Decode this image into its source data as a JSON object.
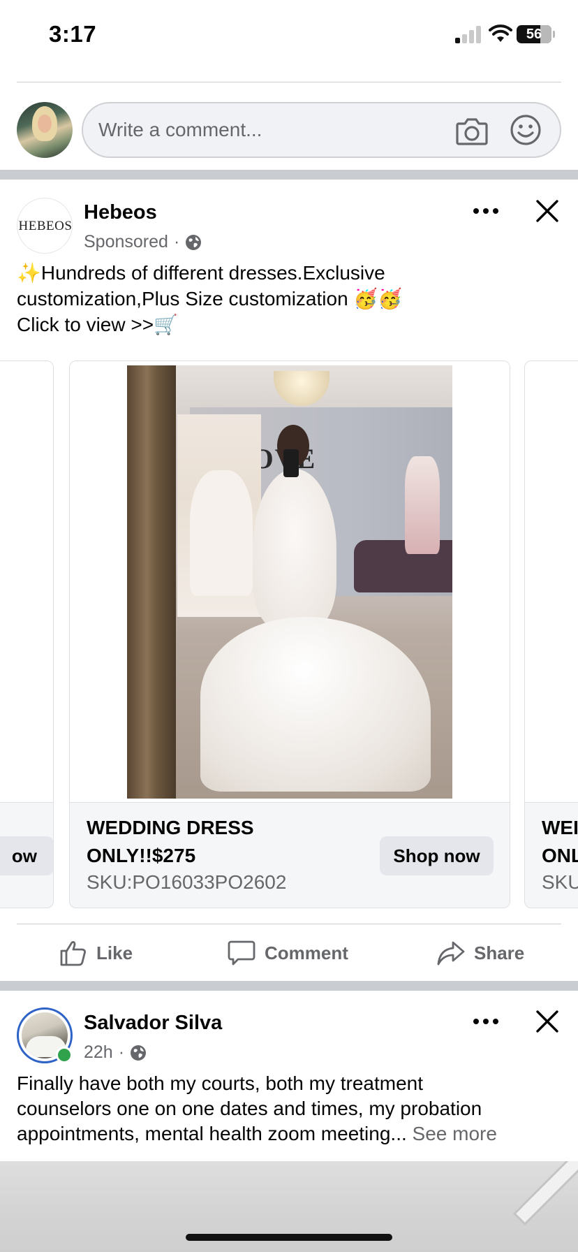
{
  "status_bar": {
    "time": "3:17",
    "battery": "56"
  },
  "composer": {
    "placeholder": "Write a comment..."
  },
  "ad_post": {
    "page_name": "Hebeos",
    "logo_text": "HEBEOS",
    "sponsored_label": "Sponsored",
    "meta_dot": "·",
    "text_lines": [
      "✨Hundreds of different dresses.Exclusive",
      "customization,Plus Size customization 🥳🥳",
      "Click to view >>🛒"
    ],
    "carousel": {
      "prev_card": {
        "button_label_partial": "ow"
      },
      "main_card": {
        "title_line1": "WEDDING DRESS",
        "title_line2": "ONLY!!$275",
        "sku": "SKU:PO16033PO2602",
        "button_label": "Shop now",
        "photo_wall_text": "LOVE"
      },
      "next_card": {
        "title_line1": "WEI",
        "title_line2": "ONL",
        "sku": "SKU"
      }
    },
    "actions": {
      "like": "Like",
      "comment": "Comment",
      "share": "Share"
    }
  },
  "post2": {
    "author": "Salvador Silva",
    "time": "22h",
    "meta_dot": "·",
    "text_lines": [
      "Finally have both my courts, both my treatment",
      "counselors one on one dates and times, my probation",
      "appointments, mental health zoom meeting..."
    ],
    "see_more": "See more"
  },
  "colors": {
    "secondary_text": "#65676b",
    "divider": "#c9ccd1",
    "online": "#31a24c",
    "story_ring": "#2d62c7"
  }
}
